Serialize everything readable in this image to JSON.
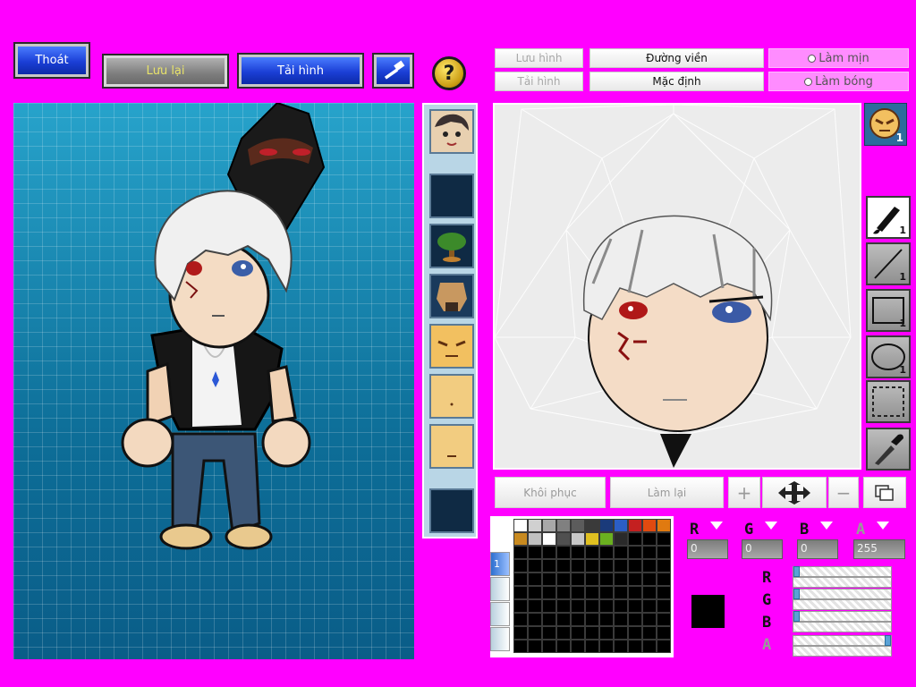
{
  "toolbar": {
    "exit_label": "Thoát",
    "save_label": "Lưu lại",
    "load_label": "Tải hình",
    "help_label": "?"
  },
  "editor_buttons": {
    "save_image": "Lưu hình",
    "load_image": "Tải hình",
    "outline": "Đường viền",
    "default": "Mặc định",
    "smooth": "Làm mịn",
    "shade": "Làm bóng",
    "restore": "Khôi phục",
    "redo": "Làm lại"
  },
  "face_tool_count": "1",
  "tools": [
    {
      "name": "brush-tool",
      "count": "1"
    },
    {
      "name": "line-tool",
      "count": "1"
    },
    {
      "name": "rectangle-tool",
      "count": "1"
    },
    {
      "name": "ellipse-tool",
      "count": "1"
    },
    {
      "name": "select-tool",
      "count": ""
    },
    {
      "name": "eyedropper-tool",
      "count": ""
    }
  ],
  "palette": {
    "tab_label": "1",
    "colors": [
      "#ffffff",
      "#d0d0d0",
      "#a8a8a8",
      "#808080",
      "#5c5c5c",
      "#3a3a3a",
      "#1a3a7a",
      "#2b5ec5",
      "#c42020",
      "#e04a10",
      "#e07a10",
      "#c88a20",
      "#c0c0c0",
      "#ffffff",
      "#505050",
      "#c8c8c8",
      "#e0c020",
      "#6ab020",
      "#2a2a2a"
    ]
  },
  "channels": {
    "r_label": "R",
    "g_label": "G",
    "b_label": "B",
    "a_label": "A",
    "r": "0",
    "g": "0",
    "b": "0",
    "a": "255",
    "r_level": 0,
    "g_level": 0,
    "b_level": 0,
    "a_level": 1
  },
  "colors": {
    "background": "#ff00ff",
    "current_color": "#000000"
  }
}
